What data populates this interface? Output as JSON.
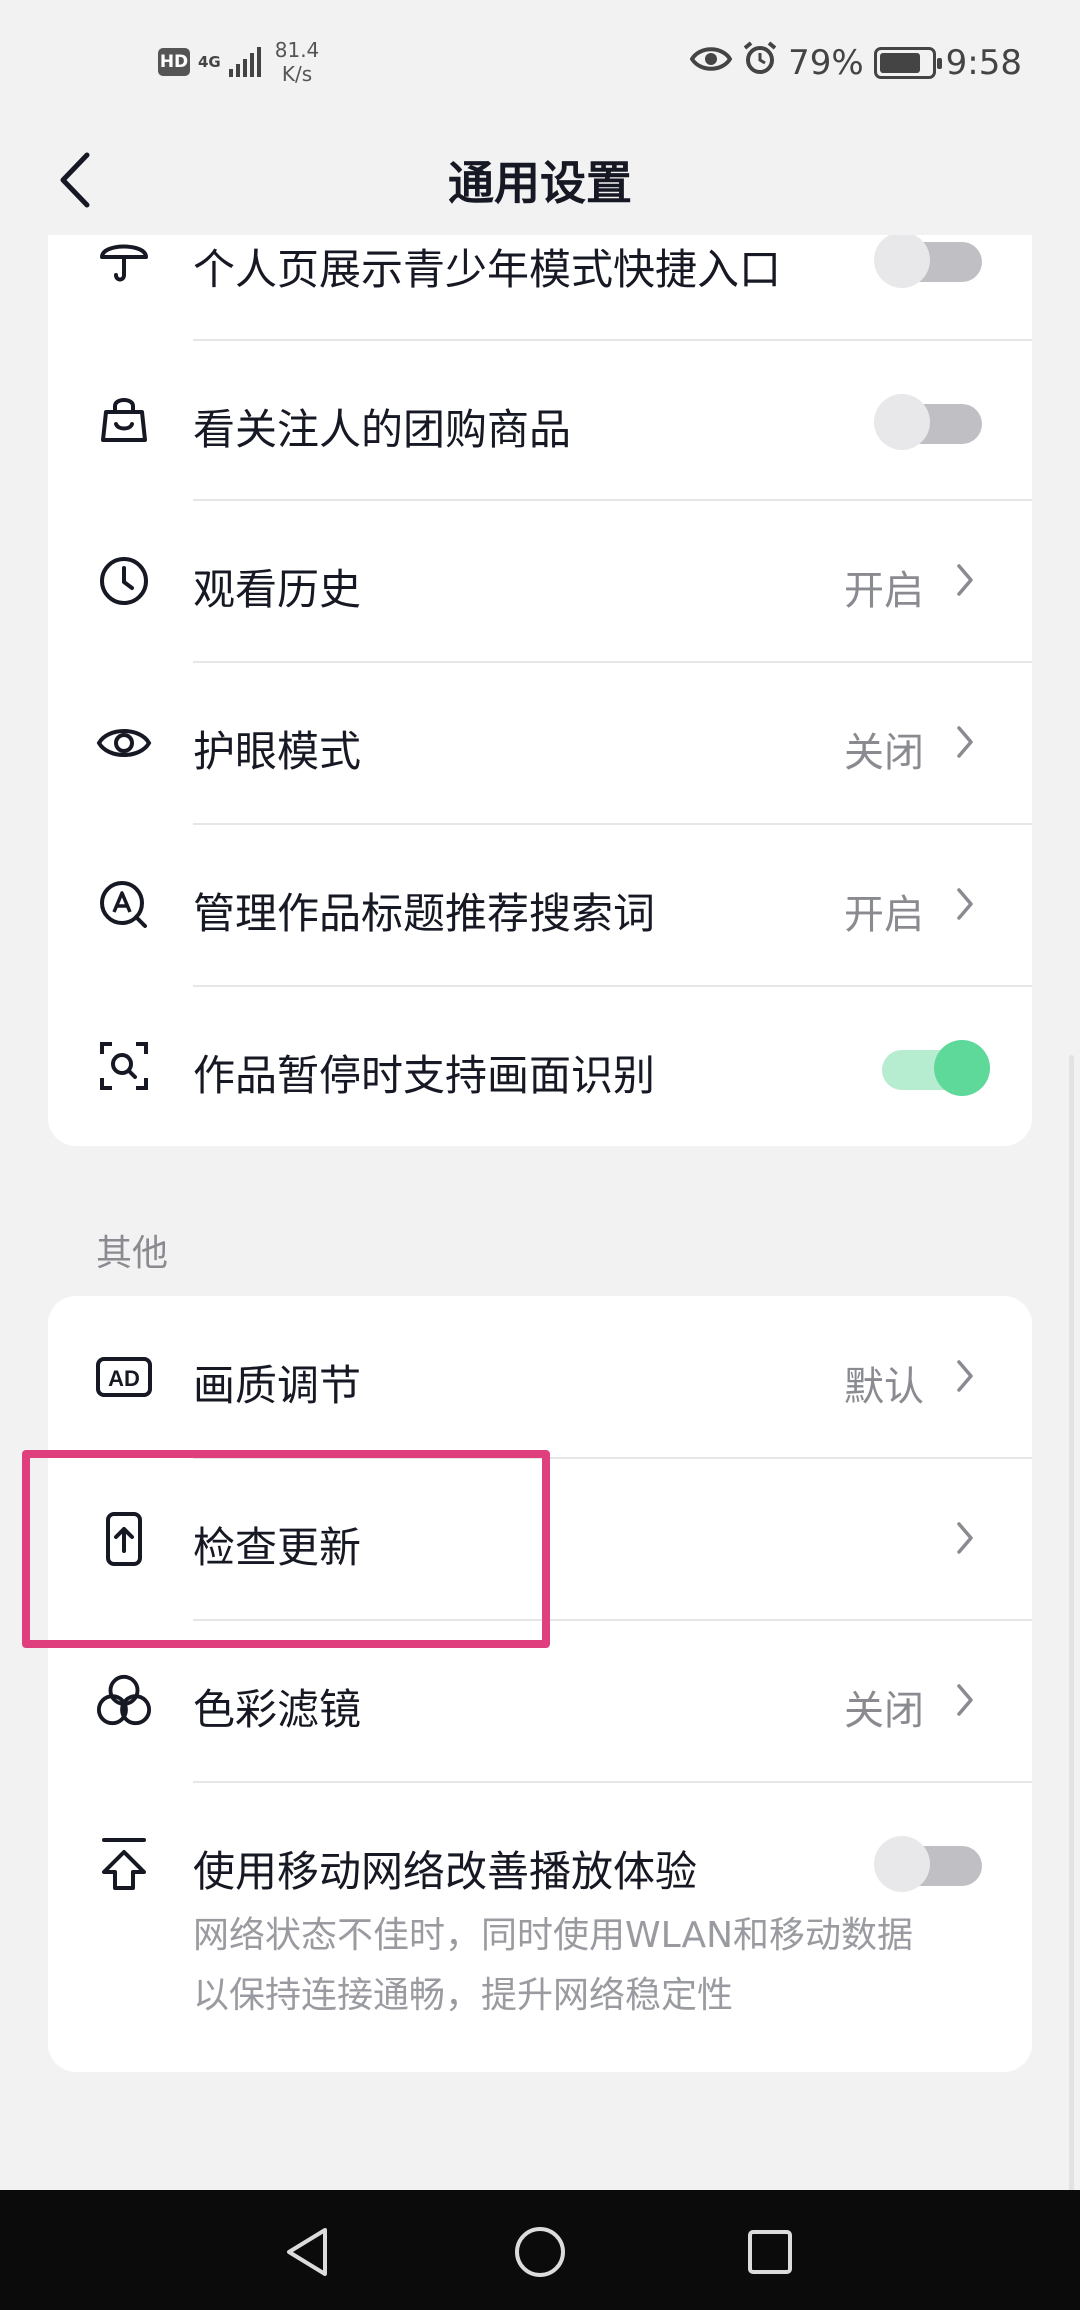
{
  "status_bar": {
    "hd": "HD",
    "network_type": "4G",
    "net_speed_value": "81.4",
    "net_speed_unit": "K/s",
    "battery": "79%",
    "battery_level": 0.79,
    "time": "9:58"
  },
  "header": {
    "title": "通用设置"
  },
  "group1": {
    "items": [
      {
        "label": "个人页展示青少年模式快捷入口",
        "icon": "umbrella-icon",
        "toggle": "off"
      },
      {
        "label": "看关注人的团购商品",
        "icon": "shopping-bag-icon",
        "toggle": "off"
      },
      {
        "label": "观看历史",
        "icon": "clock-icon",
        "value": "开启"
      },
      {
        "label": "护眼模式",
        "icon": "eye-icon",
        "value": "关闭"
      },
      {
        "label": "管理作品标题推荐搜索词",
        "icon": "search-a-icon",
        "value": "开启"
      },
      {
        "label": "作品暂停时支持画面识别",
        "icon": "scan-search-icon",
        "toggle": "on"
      }
    ]
  },
  "section_other": "其他",
  "group2": {
    "items": [
      {
        "label": "画质调节",
        "icon": "ad-icon",
        "value": "默认"
      },
      {
        "label": "检查更新",
        "icon": "phone-upload-icon"
      },
      {
        "label": "色彩滤镜",
        "icon": "color-circles-icon",
        "value": "关闭"
      },
      {
        "label": "使用移动网络改善播放体验",
        "icon": "upload-arrow-icon",
        "toggle": "off",
        "desc_line1": "网络状态不佳时，同时使用WLAN和移动数据",
        "desc_line2": "以保持连接通畅，提升网络稳定性"
      }
    ]
  },
  "colors": {
    "toggle_on": "#5ed99a",
    "highlight": "#e03f7d"
  }
}
